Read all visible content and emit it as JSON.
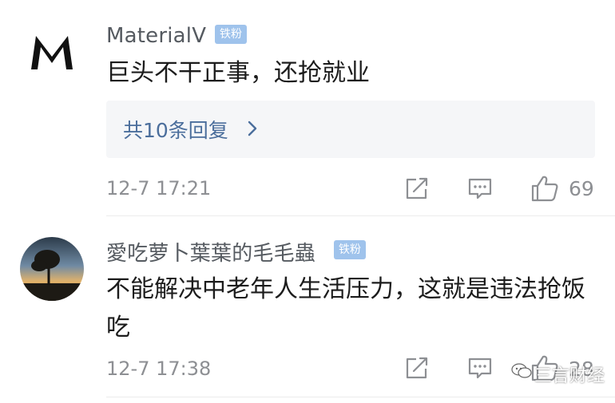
{
  "comments": [
    {
      "username": "MaterialV",
      "badge": "铁粉",
      "text": "巨头不干正事，还抢就业",
      "replies_label": "共10条回复",
      "timestamp": "12-7 17:21",
      "likes": "69"
    },
    {
      "username": "愛吃萝卜葉葉的毛毛蟲",
      "badge": "铁粉",
      "text": "不能解决中老年人生活压力，这就是违法抢饭吃",
      "timestamp": "12-7 17:38",
      "likes": "28"
    }
  ],
  "watermark": {
    "text": "三言财经"
  },
  "icons": {
    "share": "share-icon",
    "comment": "comment-icon",
    "like": "thumbs-up-icon",
    "chevron": "chevron-right-icon",
    "wechat": "wechat-icon"
  },
  "colors": {
    "badge": "#9fc3ec",
    "reply_link": "#4b6e9c",
    "meta": "#8d8f93",
    "text": "#1c1c1c"
  }
}
